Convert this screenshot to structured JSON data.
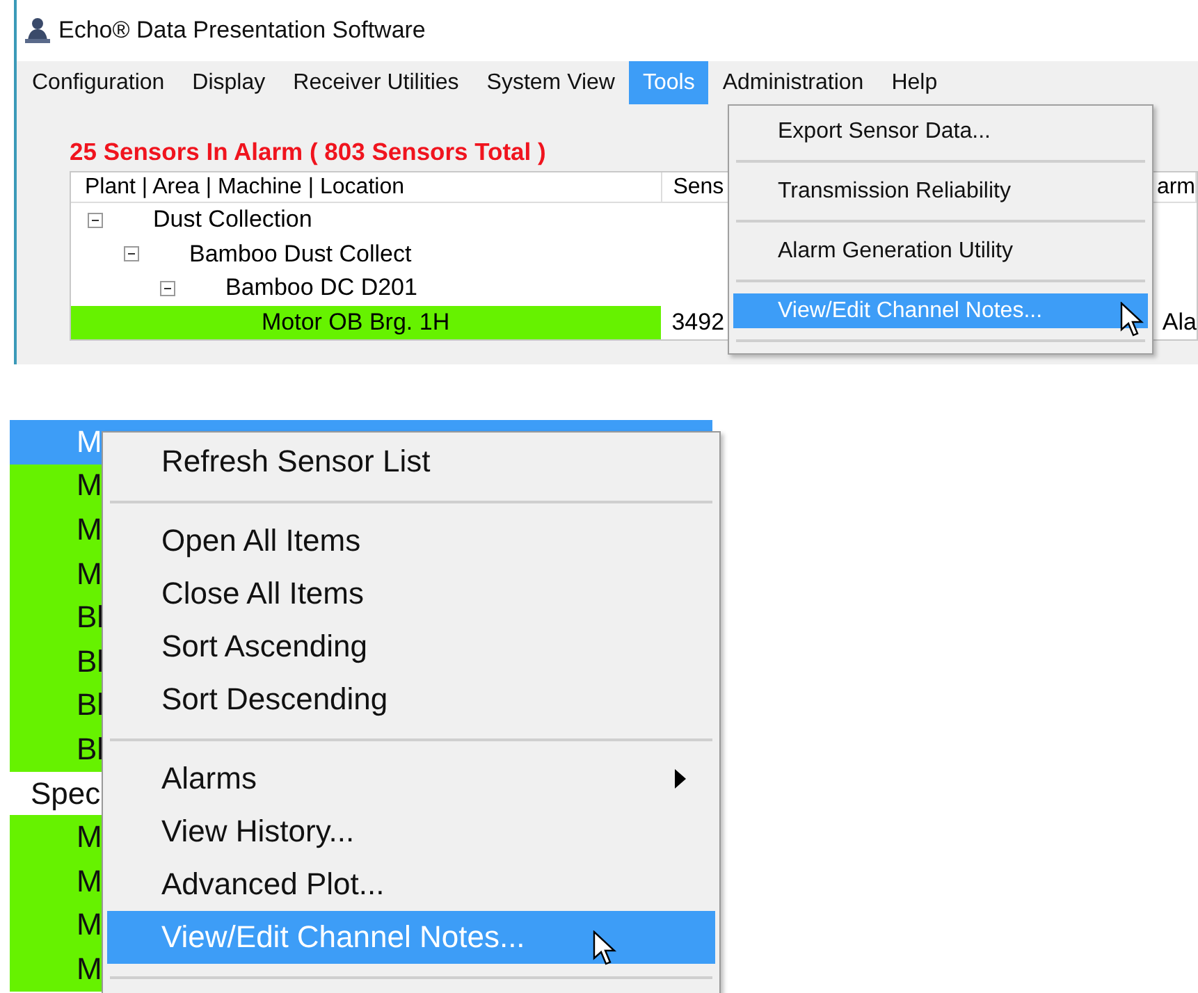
{
  "window": {
    "title": "Echo® Data Presentation Software"
  },
  "menu_bar": [
    {
      "label": "Configuration",
      "selected": false
    },
    {
      "label": "Display",
      "selected": false
    },
    {
      "label": "Receiver Utilities",
      "selected": false
    },
    {
      "label": "System View",
      "selected": false
    },
    {
      "label": "Tools",
      "selected": true
    },
    {
      "label": "Administration",
      "selected": false
    },
    {
      "label": "Help",
      "selected": false
    }
  ],
  "alarm_summary": "25 Sensors In Alarm ( 803 Sensors Total )",
  "sensor_tree": {
    "columns": [
      "Plant | Area | Machine | Location",
      "Sens",
      "arm"
    ],
    "rows": [
      {
        "label": "Dust Collection",
        "expanded": true,
        "alarm": false,
        "children": [
          {
            "label": "Bamboo Dust Collect",
            "expanded": true,
            "alarm": false,
            "children": [
              {
                "label": "Bamboo DC D201",
                "expanded": true,
                "alarm": false,
                "children": [
                  {
                    "label": "Motor OB Brg. 1H",
                    "alarm": true,
                    "column_2": "3492",
                    "column_3": "Ala"
                  }
                ]
              }
            ]
          }
        ]
      }
    ]
  },
  "tools_menu": [
    {
      "kind": "item",
      "label": "Export Sensor Data...",
      "selected": false
    },
    {
      "kind": "separator"
    },
    {
      "kind": "item",
      "label": "Transmission Reliability",
      "selected": false
    },
    {
      "kind": "separator"
    },
    {
      "kind": "item",
      "label": "Alarm Generation Utility",
      "selected": false
    },
    {
      "kind": "separator"
    },
    {
      "kind": "item",
      "label": "View/Edit Channel Notes...",
      "selected": true
    },
    {
      "kind": "separator"
    }
  ],
  "sensor_list": [
    {
      "kind": "sensor",
      "label": "M",
      "selected": true
    },
    {
      "kind": "sensor",
      "label": "M",
      "selected": false,
      "alarm": true
    },
    {
      "kind": "sensor",
      "label": "M",
      "selected": false,
      "alarm": true
    },
    {
      "kind": "sensor",
      "label": "M",
      "selected": false,
      "alarm": true
    },
    {
      "kind": "sensor",
      "label": "Bl",
      "selected": false,
      "alarm": true
    },
    {
      "kind": "sensor",
      "label": "Bl",
      "selected": false,
      "alarm": true
    },
    {
      "kind": "sensor",
      "label": "Bl",
      "selected": false,
      "alarm": true
    },
    {
      "kind": "sensor",
      "label": "Bl",
      "selected": false,
      "alarm": true
    },
    {
      "kind": "group",
      "label": "Spec",
      "selected": false,
      "alarm": false
    },
    {
      "kind": "sensor",
      "label": "M",
      "selected": false,
      "alarm": true
    },
    {
      "kind": "sensor",
      "label": "M",
      "selected": false,
      "alarm": true
    },
    {
      "kind": "sensor",
      "label": "M",
      "selected": false,
      "alarm": true
    },
    {
      "kind": "sensor",
      "label": "M",
      "selected": false,
      "alarm": true
    }
  ],
  "context_menu": [
    {
      "kind": "item",
      "label": "Refresh Sensor List",
      "selected": false
    },
    {
      "kind": "separator"
    },
    {
      "kind": "item",
      "label": "Open All Items",
      "selected": false
    },
    {
      "kind": "item",
      "label": "Close All Items",
      "selected": false
    },
    {
      "kind": "item",
      "label": "Sort Ascending",
      "selected": false
    },
    {
      "kind": "item",
      "label": "Sort Descending",
      "selected": false
    },
    {
      "kind": "separator"
    },
    {
      "kind": "submenu",
      "label": "Alarms",
      "selected": false
    },
    {
      "kind": "item",
      "label": "View History...",
      "selected": false
    },
    {
      "kind": "item",
      "label": "Advanced Plot...",
      "selected": false
    },
    {
      "kind": "item",
      "label": "View/Edit Channel Notes...",
      "selected": true
    },
    {
      "kind": "separator"
    }
  ]
}
